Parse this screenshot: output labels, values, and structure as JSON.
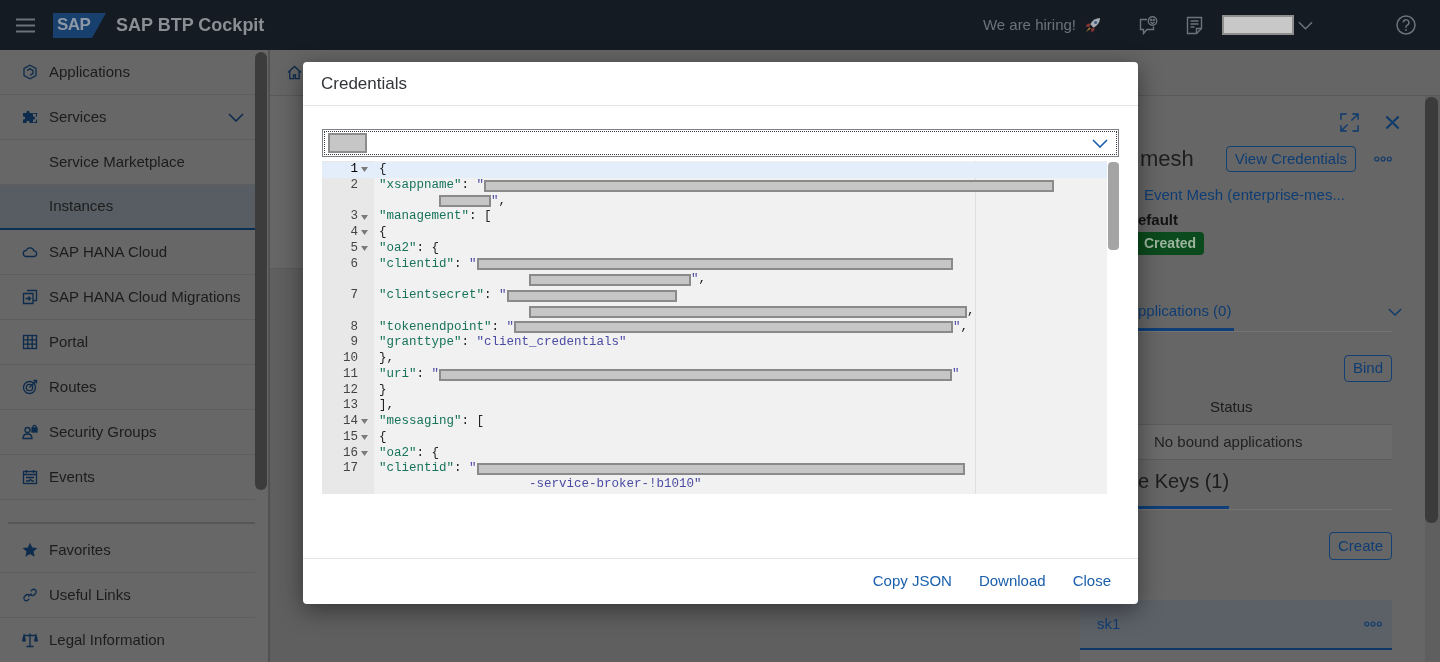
{
  "shell": {
    "logo": "SAP",
    "title": "SAP BTP Cockpit",
    "hiring_link": "We are hiring!"
  },
  "sidebar": {
    "items": [
      {
        "label": "Applications",
        "selected": false
      },
      {
        "label": "Services",
        "selected": false,
        "expanded": true,
        "children": [
          {
            "label": "Service Marketplace",
            "selected": false
          },
          {
            "label": "Instances",
            "selected": true
          }
        ]
      },
      {
        "label": "SAP HANA Cloud",
        "selected": false
      },
      {
        "label": "SAP HANA Cloud Migrations",
        "selected": false
      },
      {
        "label": "Portal",
        "selected": false
      },
      {
        "label": "Routes",
        "selected": false
      },
      {
        "label": "Security Groups",
        "selected": false
      },
      {
        "label": "Events",
        "selected": false
      }
    ],
    "footer_items": [
      {
        "label": "Favorites",
        "selected": false
      },
      {
        "label": "Useful Links",
        "selected": false
      },
      {
        "label": "Legal Information",
        "selected": false
      }
    ]
  },
  "detail_panel": {
    "title": "mesh",
    "view_credentials_button": "View Credentials",
    "service_link": "Event Mesh (enterprise-mes...",
    "plan": "efault",
    "status": "Created",
    "tabs": [
      {
        "label": "pplications (0)",
        "selected": true
      }
    ],
    "bind_button": "Bind",
    "bindings_table": {
      "columns": [
        "Status"
      ],
      "empty_text": "No bound applications"
    },
    "key_tabs": [
      {
        "label": "e Keys (1)",
        "selected": true
      }
    ],
    "create_button": "Create",
    "keys": [
      {
        "name": "sk1",
        "selected": true
      }
    ]
  },
  "dialog": {
    "title": "Credentials",
    "selector": {
      "focused": true
    },
    "editor": {
      "lines": [
        {
          "number": "1",
          "foldable": true,
          "active": true,
          "rows": [
            [
              {
                "kind": "punct",
                "text": "{"
              }
            ]
          ]
        },
        {
          "number": "2",
          "foldable": false,
          "active": false,
          "rows": [
            [
              {
                "kind": "key",
                "text": "    \"xsappname\""
              },
              {
                "kind": "punct",
                "text": ": "
              },
              {
                "kind": "string",
                "text": "\""
              },
              {
                "kind": "redacted"
              }
            ],
            [
              {
                "kind": "redacted"
              },
              {
                "kind": "string",
                "text": "\""
              },
              {
                "kind": "punct",
                "text": ","
              }
            ]
          ]
        },
        {
          "number": "3",
          "foldable": true,
          "active": false,
          "rows": [
            [
              {
                "kind": "key",
                "text": "    \"management\""
              },
              {
                "kind": "punct",
                "text": ": ["
              }
            ]
          ]
        },
        {
          "number": "4",
          "foldable": true,
          "active": false,
          "rows": [
            [
              {
                "kind": "punct",
                "text": "        {"
              }
            ]
          ]
        },
        {
          "number": "5",
          "foldable": true,
          "active": false,
          "rows": [
            [
              {
                "kind": "key",
                "text": "            \"oa2\""
              },
              {
                "kind": "punct",
                "text": ": {"
              }
            ]
          ]
        },
        {
          "number": "6",
          "foldable": false,
          "active": false,
          "rows": [
            [
              {
                "kind": "key",
                "text": "                \"clientid\""
              },
              {
                "kind": "punct",
                "text": ": "
              },
              {
                "kind": "string",
                "text": "\""
              },
              {
                "kind": "redacted"
              }
            ],
            [
              {
                "kind": "redacted"
              },
              {
                "kind": "string",
                "text": "\""
              },
              {
                "kind": "punct",
                "text": ","
              }
            ]
          ]
        },
        {
          "number": "7",
          "foldable": false,
          "active": false,
          "rows": [
            [
              {
                "kind": "key",
                "text": "                \"clientsecret\""
              },
              {
                "kind": "punct",
                "text": ": "
              },
              {
                "kind": "string",
                "text": "\""
              },
              {
                "kind": "redacted"
              }
            ],
            [
              {
                "kind": "redacted"
              },
              {
                "kind": "punct",
                "text": ","
              }
            ]
          ]
        },
        {
          "number": "8",
          "foldable": false,
          "active": false,
          "rows": [
            [
              {
                "kind": "key",
                "text": "                \"tokenendpoint\""
              },
              {
                "kind": "punct",
                "text": ": "
              },
              {
                "kind": "string",
                "text": "\""
              },
              {
                "kind": "redacted"
              },
              {
                "kind": "string",
                "text": "\""
              },
              {
                "kind": "punct",
                "text": ","
              }
            ]
          ]
        },
        {
          "number": "9",
          "foldable": false,
          "active": false,
          "rows": [
            [
              {
                "kind": "key",
                "text": "                \"granttype\""
              },
              {
                "kind": "punct",
                "text": ": "
              },
              {
                "kind": "string",
                "text": "\"client_credentials\""
              }
            ]
          ]
        },
        {
          "number": "10",
          "foldable": false,
          "active": false,
          "rows": [
            [
              {
                "kind": "punct",
                "text": "            },"
              }
            ]
          ]
        },
        {
          "number": "11",
          "foldable": false,
          "active": false,
          "rows": [
            [
              {
                "kind": "key",
                "text": "            \"uri\""
              },
              {
                "kind": "punct",
                "text": ": "
              },
              {
                "kind": "string",
                "text": "\""
              },
              {
                "kind": "redacted"
              },
              {
                "kind": "string",
                "text": "\""
              }
            ]
          ]
        },
        {
          "number": "12",
          "foldable": false,
          "active": false,
          "rows": [
            [
              {
                "kind": "punct",
                "text": "        }"
              }
            ]
          ]
        },
        {
          "number": "13",
          "foldable": false,
          "active": false,
          "rows": [
            [
              {
                "kind": "punct",
                "text": "    ],"
              }
            ]
          ]
        },
        {
          "number": "14",
          "foldable": true,
          "active": false,
          "rows": [
            [
              {
                "kind": "key",
                "text": "    \"messaging\""
              },
              {
                "kind": "punct",
                "text": ": ["
              }
            ]
          ]
        },
        {
          "number": "15",
          "foldable": true,
          "active": false,
          "rows": [
            [
              {
                "kind": "punct",
                "text": "        {"
              }
            ]
          ]
        },
        {
          "number": "16",
          "foldable": true,
          "active": false,
          "rows": [
            [
              {
                "kind": "key",
                "text": "            \"oa2\""
              },
              {
                "kind": "punct",
                "text": ": {"
              }
            ]
          ]
        },
        {
          "number": "17",
          "foldable": false,
          "active": false,
          "rows": [
            [
              {
                "kind": "key",
                "text": "                \"clientid\""
              },
              {
                "kind": "punct",
                "text": ": "
              },
              {
                "kind": "string",
                "text": "\""
              },
              {
                "kind": "redacted"
              }
            ],
            [
              {
                "kind": "string",
                "text": "-service-broker-!b1010\""
              }
            ]
          ]
        }
      ]
    },
    "actions": [
      "Copy JSON",
      "Download",
      "Close"
    ]
  }
}
